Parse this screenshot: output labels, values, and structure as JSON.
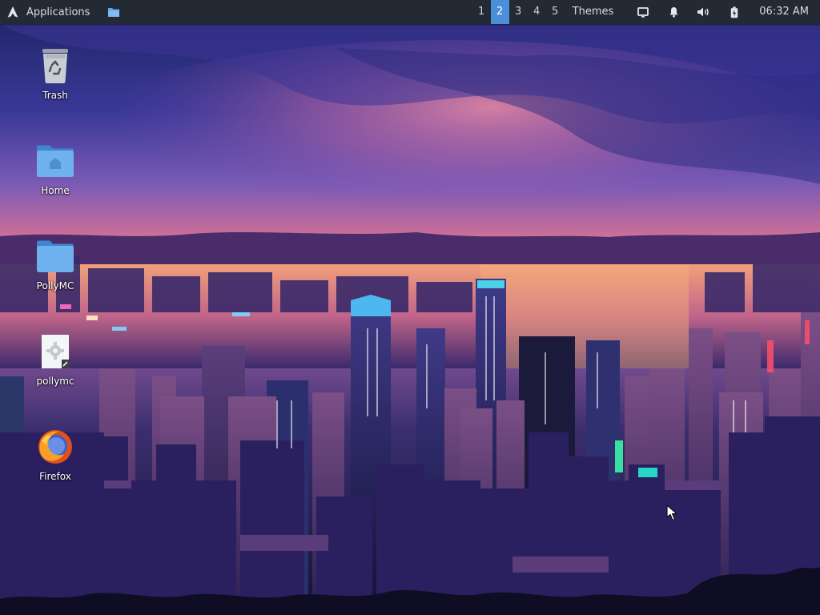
{
  "panel": {
    "applications_label": "Applications",
    "workspaces": [
      "1",
      "2",
      "3",
      "4",
      "5"
    ],
    "active_workspace": "2",
    "themes_label": "Themes",
    "clock": "06:32 AM",
    "icons": {
      "menu": "arch-logo-icon",
      "launcher": "file-manager-icon",
      "display": "display-icon",
      "notifications": "bell-icon",
      "volume": "volume-icon",
      "battery": "battery-charging-icon"
    },
    "colors": {
      "panel_bg": "#232a33",
      "active_workspace_bg": "#4a90d9",
      "text": "#d8dde3"
    }
  },
  "desktop": {
    "icons": [
      {
        "label": "Trash",
        "icon": "trash-icon"
      },
      {
        "label": "Home",
        "icon": "home-folder-icon"
      },
      {
        "label": "PollyMC",
        "icon": "folder-icon"
      },
      {
        "label": "pollymc",
        "icon": "executable-file-icon"
      },
      {
        "label": "Firefox",
        "icon": "firefox-icon"
      }
    ]
  }
}
